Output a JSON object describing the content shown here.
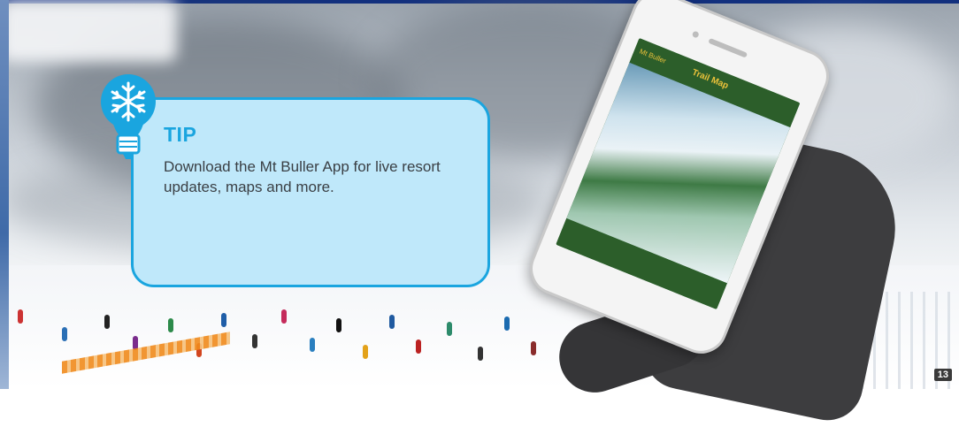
{
  "tip": {
    "title": "TIP",
    "body": "Download the Mt Buller App for live resort updates, maps and more.",
    "icon": "snowflake-lightbulb-icon"
  },
  "phone_app": {
    "back_label": "Mt Buller",
    "screen_title": "Trail Map"
  },
  "page_number": "13",
  "colors": {
    "accent": "#1aa5df",
    "card_fill": "#bfe8fa",
    "body_text": "#3a3f44",
    "top_band": "#12307e"
  }
}
